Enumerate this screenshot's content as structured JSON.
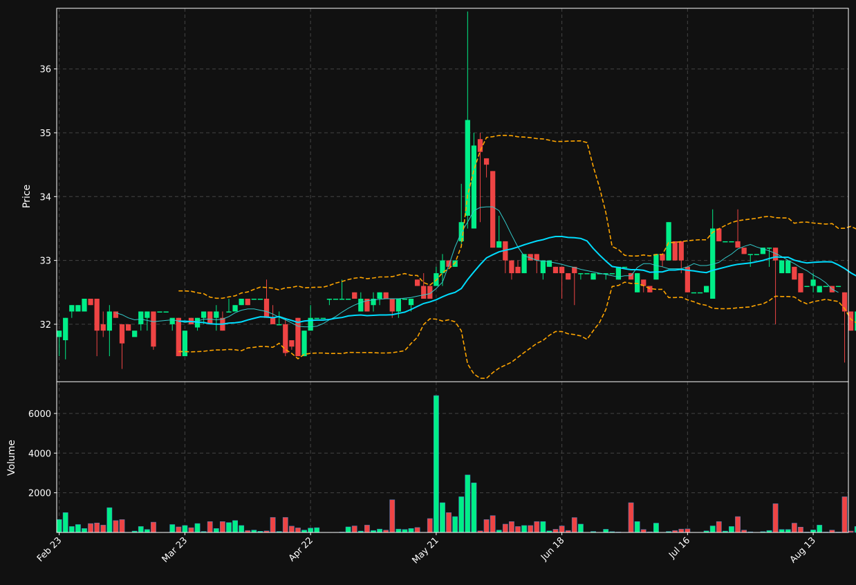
{
  "chart_data": {
    "type": "candlestick",
    "colors": {
      "background": "#111111",
      "up": "#00ee88",
      "down": "#ee4444",
      "volume_outline": "#4488cc",
      "ma_fast": "#33cccc",
      "ma_slow": "#00ddff",
      "bands": "#ffa500",
      "grid": "#444444",
      "text": "#ffffff"
    },
    "price_panel": {
      "ylabel": "Price",
      "ylim": [
        31.1,
        36.95
      ],
      "yticks": [
        32,
        33,
        34,
        35,
        36
      ]
    },
    "volume_panel": {
      "ylabel": "Volume",
      "ylim": [
        0,
        7600
      ],
      "yticks": [
        2000,
        4000,
        6000
      ]
    },
    "x_tick_labels": [
      {
        "label": "Feb 23",
        "idx": 0
      },
      {
        "label": "Mar 23",
        "idx": 20
      },
      {
        "label": "Apr 22",
        "idx": 40
      },
      {
        "label": "May 21",
        "idx": 60
      },
      {
        "label": "Jun 18",
        "idx": 80
      },
      {
        "label": "Jul 16",
        "idx": 100
      },
      {
        "label": "Aug 13",
        "idx": 120
      }
    ],
    "x_range": [
      -0.4,
      125.6
    ],
    "grid": true,
    "candles": [
      [
        31.8,
        31.9,
        31.5,
        31.9,
        650
      ],
      [
        31.75,
        32.1,
        31.45,
        32.1,
        1000
      ],
      [
        32.2,
        32.3,
        32.1,
        32.3,
        300
      ],
      [
        32.2,
        32.3,
        32.2,
        32.3,
        400
      ],
      [
        32.2,
        32.4,
        32.2,
        32.4,
        200
      ],
      [
        32.4,
        32.4,
        32.3,
        32.3,
        450
      ],
      [
        32.4,
        32.4,
        31.5,
        31.9,
        480
      ],
      [
        32.0,
        32.2,
        31.8,
        31.9,
        370
      ],
      [
        31.9,
        32.3,
        31.5,
        32.2,
        1250
      ],
      [
        32.2,
        32.2,
        32.1,
        32.1,
        600
      ],
      [
        32.0,
        32.0,
        31.3,
        31.7,
        650
      ],
      [
        32.0,
        32.0,
        31.9,
        31.9,
        10
      ],
      [
        31.8,
        31.8,
        31.8,
        31.9,
        70
      ],
      [
        32.0,
        32.2,
        31.9,
        32.2,
        300
      ],
      [
        32.1,
        32.2,
        31.9,
        32.2,
        150
      ],
      [
        32.2,
        32.2,
        31.6,
        31.65,
        520
      ],
      [
        32.2,
        32.2,
        32.2,
        32.2,
        10
      ],
      [
        32.2,
        32.2,
        32.2,
        32.2,
        10
      ],
      [
        32.0,
        32.0,
        31.9,
        32.1,
        400
      ],
      [
        32.1,
        32.1,
        31.5,
        31.5,
        280
      ],
      [
        31.5,
        31.9,
        31.5,
        31.9,
        350
      ],
      [
        32.1,
        32.1,
        32.0,
        32.0,
        240
      ],
      [
        31.95,
        32.1,
        31.9,
        32.1,
        450
      ],
      [
        32.1,
        32.2,
        32.0,
        32.2,
        50
      ],
      [
        32.2,
        32.2,
        32.0,
        32.0,
        550
      ],
      [
        32.1,
        32.3,
        31.9,
        32.2,
        200
      ],
      [
        32.1,
        32.2,
        31.9,
        31.9,
        550
      ],
      [
        32.2,
        32.4,
        32.2,
        32.2,
        500
      ],
      [
        32.2,
        32.3,
        32.2,
        32.3,
        600
      ],
      [
        32.3,
        32.4,
        32.3,
        32.4,
        350
      ],
      [
        32.4,
        32.4,
        32.3,
        32.3,
        100
      ],
      [
        32.4,
        32.4,
        32.4,
        32.4,
        120
      ],
      [
        32.4,
        32.4,
        32.4,
        32.4,
        60
      ],
      [
        32.4,
        32.7,
        32.1,
        32.1,
        80
      ],
      [
        32.1,
        32.3,
        32.0,
        32.0,
        760
      ],
      [
        32.0,
        32.2,
        32.0,
        32.0,
        50
      ],
      [
        32.0,
        32.1,
        31.5,
        31.55,
        760
      ],
      [
        31.75,
        31.75,
        31.6,
        31.65,
        320
      ],
      [
        32.1,
        32.1,
        31.5,
        31.5,
        230
      ],
      [
        31.5,
        31.9,
        31.5,
        31.9,
        120
      ],
      [
        31.9,
        32.3,
        31.9,
        32.1,
        220
      ],
      [
        32.1,
        32.1,
        32.1,
        32.1,
        240
      ],
      [
        32.1,
        32.1,
        32.1,
        32.1,
        10
      ],
      [
        32.4,
        32.4,
        32.3,
        32.4,
        10
      ],
      [
        32.4,
        32.4,
        32.4,
        32.4,
        10
      ],
      [
        32.4,
        32.7,
        32.4,
        32.4,
        20
      ],
      [
        32.4,
        32.4,
        32.4,
        32.4,
        280
      ],
      [
        32.5,
        32.5,
        32.4,
        32.4,
        330
      ],
      [
        32.2,
        32.5,
        32.2,
        32.4,
        70
      ],
      [
        32.4,
        32.4,
        32.2,
        32.2,
        370
      ],
      [
        32.3,
        32.5,
        32.2,
        32.4,
        100
      ],
      [
        32.4,
        32.5,
        32.3,
        32.5,
        170
      ],
      [
        32.5,
        32.5,
        32.4,
        32.4,
        120
      ],
      [
        32.4,
        32.4,
        32.1,
        32.2,
        1650
      ],
      [
        32.2,
        32.4,
        32.1,
        32.4,
        170
      ],
      [
        32.4,
        32.4,
        32.4,
        32.4,
        150
      ],
      [
        32.3,
        32.4,
        32.2,
        32.4,
        200
      ],
      [
        32.7,
        32.7,
        32.6,
        32.6,
        250
      ],
      [
        32.6,
        32.8,
        32.4,
        32.4,
        10
      ],
      [
        32.6,
        32.6,
        32.4,
        32.4,
        700
      ],
      [
        32.6,
        32.9,
        32.6,
        32.8,
        6900
      ],
      [
        32.8,
        33.1,
        32.6,
        33.0,
        1500
      ],
      [
        33.0,
        33.0,
        32.9,
        32.9,
        1000
      ],
      [
        32.9,
        33.0,
        32.9,
        33.0,
        800
      ],
      [
        33.3,
        34.2,
        33.2,
        33.6,
        1800
      ],
      [
        33.7,
        36.9,
        33.5,
        35.2,
        2900
      ],
      [
        33.5,
        35.0,
        33.5,
        34.8,
        2500
      ],
      [
        34.9,
        35.0,
        33.6,
        34.7,
        80
      ],
      [
        34.6,
        34.6,
        34.3,
        34.5,
        650
      ],
      [
        34.4,
        34.4,
        33.2,
        33.2,
        850
      ],
      [
        33.2,
        33.7,
        33.2,
        33.3,
        120
      ],
      [
        33.3,
        33.3,
        32.8,
        33.0,
        420
      ],
      [
        33.0,
        33.0,
        32.7,
        32.8,
        550
      ],
      [
        32.9,
        33.0,
        32.8,
        32.8,
        300
      ],
      [
        32.8,
        33.1,
        32.8,
        33.1,
        350
      ],
      [
        33.1,
        33.1,
        33.0,
        33.0,
        350
      ],
      [
        33.1,
        33.1,
        32.8,
        33.0,
        550
      ],
      [
        32.8,
        33.0,
        32.7,
        33.0,
        550
      ],
      [
        32.9,
        33.0,
        32.9,
        33.0,
        80
      ],
      [
        32.9,
        32.9,
        32.8,
        32.8,
        160
      ],
      [
        32.9,
        32.9,
        32.4,
        32.8,
        330
      ],
      [
        32.8,
        32.8,
        32.7,
        32.7,
        100
      ],
      [
        32.9,
        32.9,
        32.3,
        32.8,
        750
      ],
      [
        32.8,
        32.8,
        32.7,
        32.8,
        420
      ],
      [
        32.8,
        32.8,
        32.8,
        32.8,
        10
      ],
      [
        32.7,
        32.8,
        32.7,
        32.8,
        50
      ],
      [
        32.8,
        32.8,
        32.8,
        32.8,
        10
      ],
      [
        32.8,
        32.8,
        32.7,
        32.8,
        160
      ],
      [
        32.8,
        32.8,
        32.8,
        32.8,
        40
      ],
      [
        32.7,
        32.9,
        32.7,
        32.9,
        20
      ],
      [
        32.9,
        32.9,
        32.9,
        32.9,
        10
      ],
      [
        32.8,
        32.8,
        32.7,
        32.7,
        1500
      ],
      [
        32.5,
        32.8,
        32.5,
        32.8,
        550
      ],
      [
        32.7,
        32.7,
        32.5,
        32.6,
        150
      ],
      [
        32.6,
        32.6,
        32.5,
        32.5,
        30
      ],
      [
        32.7,
        33.1,
        32.7,
        33.1,
        470
      ],
      [
        33.1,
        33.1,
        32.9,
        33.0,
        10
      ],
      [
        33.0,
        33.6,
        33.0,
        33.6,
        50
      ],
      [
        33.3,
        33.3,
        33.0,
        33.0,
        100
      ],
      [
        33.3,
        33.3,
        32.8,
        33.0,
        170
      ],
      [
        32.9,
        32.9,
        32.5,
        32.5,
        180
      ],
      [
        32.5,
        32.5,
        32.5,
        32.5,
        10
      ],
      [
        32.5,
        32.5,
        32.5,
        32.5,
        10
      ],
      [
        32.5,
        32.6,
        32.5,
        32.6,
        80
      ],
      [
        32.4,
        33.8,
        32.4,
        33.5,
        330
      ],
      [
        33.5,
        33.5,
        33.3,
        33.3,
        550
      ],
      [
        33.3,
        33.3,
        33.3,
        33.3,
        70
      ],
      [
        33.3,
        33.3,
        33.3,
        33.3,
        300
      ],
      [
        33.3,
        33.8,
        33.2,
        33.2,
        800
      ],
      [
        33.2,
        33.2,
        33.1,
        33.1,
        120
      ],
      [
        33.1,
        33.1,
        32.9,
        33.1,
        30
      ],
      [
        33.1,
        33.1,
        33.1,
        33.1,
        10
      ],
      [
        33.1,
        33.2,
        33.1,
        33.2,
        40
      ],
      [
        33.2,
        33.2,
        32.9,
        33.2,
        100
      ],
      [
        33.2,
        33.2,
        32.0,
        33.0,
        1450
      ],
      [
        32.8,
        33.0,
        32.8,
        33.0,
        150
      ],
      [
        32.8,
        33.0,
        32.8,
        33.0,
        150
      ],
      [
        32.9,
        32.9,
        32.7,
        32.7,
        470
      ],
      [
        32.8,
        32.8,
        32.5,
        32.5,
        270
      ],
      [
        32.6,
        32.6,
        32.6,
        32.6,
        20
      ],
      [
        32.6,
        32.8,
        32.5,
        32.7,
        130
      ],
      [
        32.5,
        32.6,
        32.5,
        32.6,
        370
      ],
      [
        32.6,
        32.6,
        32.6,
        32.6,
        20
      ],
      [
        32.6,
        32.6,
        32.5,
        32.5,
        120
      ],
      [
        32.6,
        32.6,
        32.6,
        32.6,
        20
      ],
      [
        32.5,
        32.5,
        31.4,
        32.2,
        1800
      ],
      [
        32.2,
        32.2,
        31.9,
        31.9,
        70
      ],
      [
        31.9,
        32.3,
        31.9,
        32.2,
        300
      ]
    ],
    "ma_fast": [
      null,
      null,
      null,
      null,
      null,
      null,
      null,
      null,
      null,
      32.18,
      32.15,
      32.1,
      32.07,
      32.08,
      32.06,
      32.04,
      32.05,
      32.06,
      32.07,
      32.05,
      32.03,
      32.04,
      32.05,
      32.08,
      32.08,
      32.07,
      32.08,
      32.12,
      32.18,
      32.22,
      32.24,
      32.24,
      32.22,
      32.2,
      32.16,
      32.11,
      32.07,
      32.02,
      31.97,
      31.96,
      31.96,
      31.97,
      32.01,
      32.07,
      32.12,
      32.19,
      32.25,
      32.3,
      32.34,
      32.37,
      32.38,
      32.39,
      32.4,
      32.4,
      32.4,
      32.41,
      32.42,
      32.44,
      32.46,
      32.48,
      32.56,
      32.66,
      32.92,
      33.21,
      33.44,
      33.6,
      33.78,
      33.83,
      33.84,
      33.84,
      33.78,
      33.6,
      33.4,
      33.21,
      33.07,
      33.04,
      33.0,
      32.99,
      32.98,
      32.96,
      32.94,
      32.91,
      32.89,
      32.86,
      32.84,
      32.82,
      32.8,
      32.78,
      32.76,
      32.74,
      32.76,
      32.76,
      32.89,
      32.95,
      32.95,
      32.92,
      32.9,
      32.87,
      32.87,
      32.87,
      32.9,
      32.95,
      32.92,
      32.92,
      32.94,
      32.97,
      33.04,
      33.1,
      33.18,
      33.22,
      33.25,
      33.21,
      33.18,
      33.15,
      33.11,
      33.06,
      33.0,
      32.95,
      32.89,
      32.84,
      32.77,
      32.72,
      32.65,
      32.55,
      32.5
    ]
  }
}
